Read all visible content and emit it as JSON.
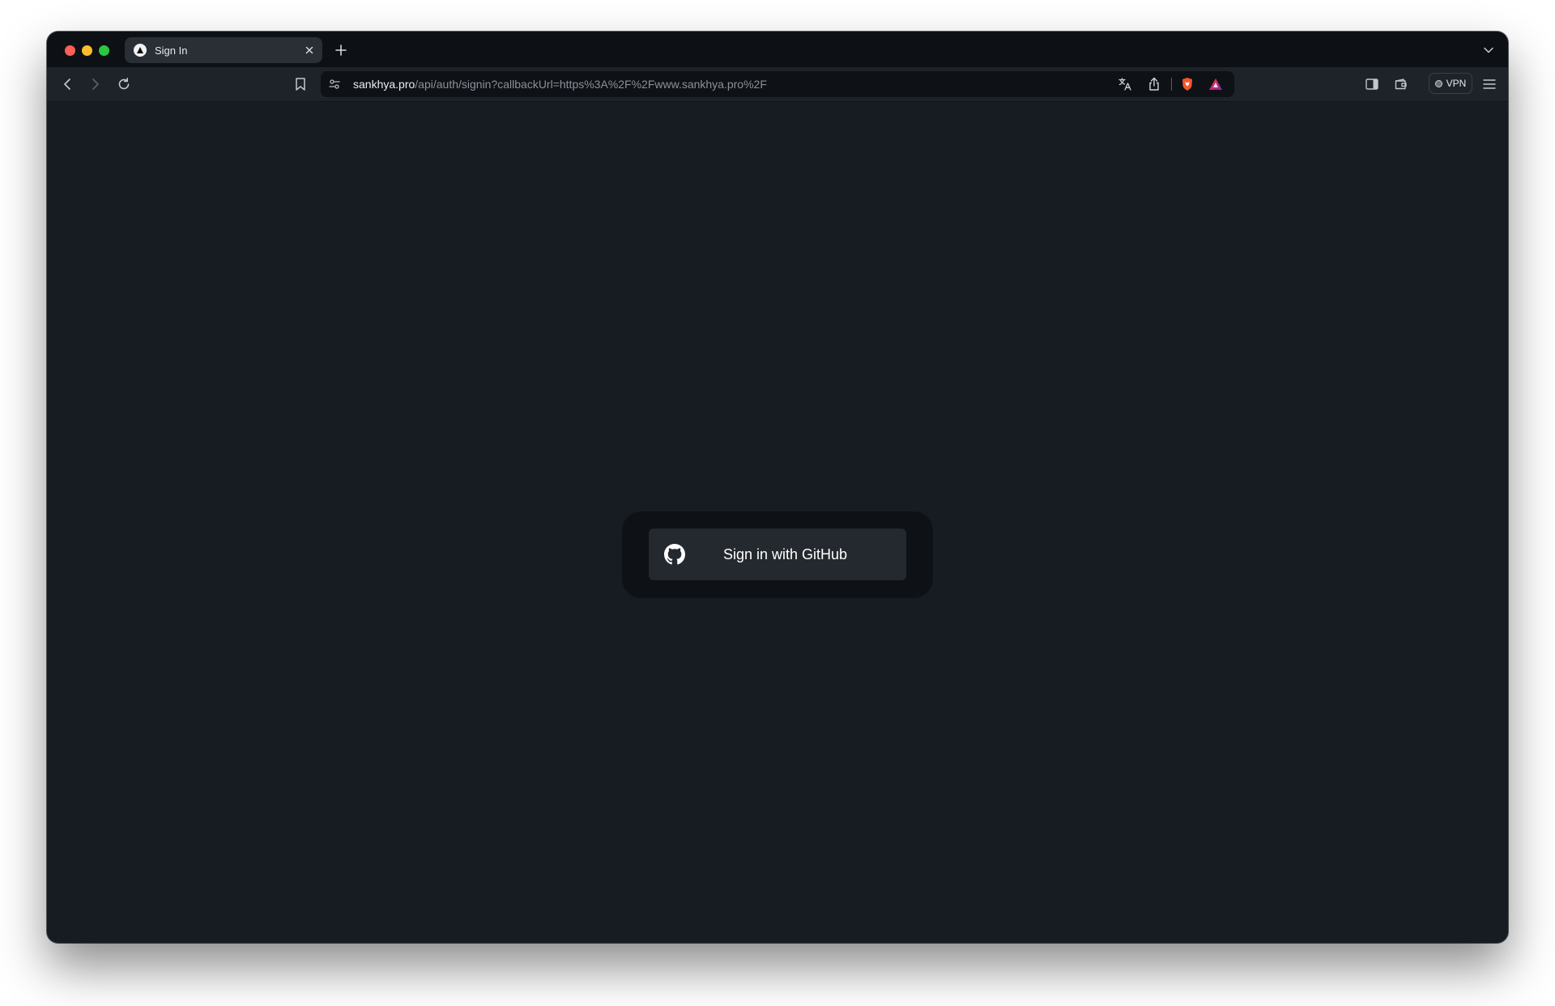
{
  "browser": {
    "tab": {
      "title": "Sign In",
      "favicon": "triangle-logo-icon"
    },
    "new_tab_icon": "plus-icon",
    "tabs_menu_icon": "chevron-down-icon",
    "toolbar": {
      "back_icon": "chevron-left-icon",
      "forward_icon": "chevron-right-icon",
      "reload_icon": "reload-icon",
      "bookmark_icon": "bookmark-icon",
      "site_settings_icon": "site-settings-icon",
      "translate_icon": "translate-icon",
      "share_icon": "share-icon",
      "shields_icon": "brave-shields-icon",
      "rewards_icon": "brave-rewards-icon",
      "sidebar_icon": "sidebar-icon",
      "wallet_icon": "wallet-icon",
      "vpn_label": "VPN",
      "menu_icon": "hamburger-menu-icon"
    },
    "url": {
      "host": "sankhya.pro",
      "path": "/api/auth/signin?callbackUrl=https%3A%2F%2Fwww.sankhya.pro%2F"
    }
  },
  "page": {
    "signin_button_label": "Sign in with GitHub",
    "signin_button_icon": "github-icon"
  },
  "colors": {
    "page_background": "#171b22",
    "card_background": "#0e1116",
    "button_background": "#24292f",
    "traffic_red": "#fe5f57",
    "traffic_yellow": "#febc2e",
    "traffic_green": "#28c840"
  }
}
